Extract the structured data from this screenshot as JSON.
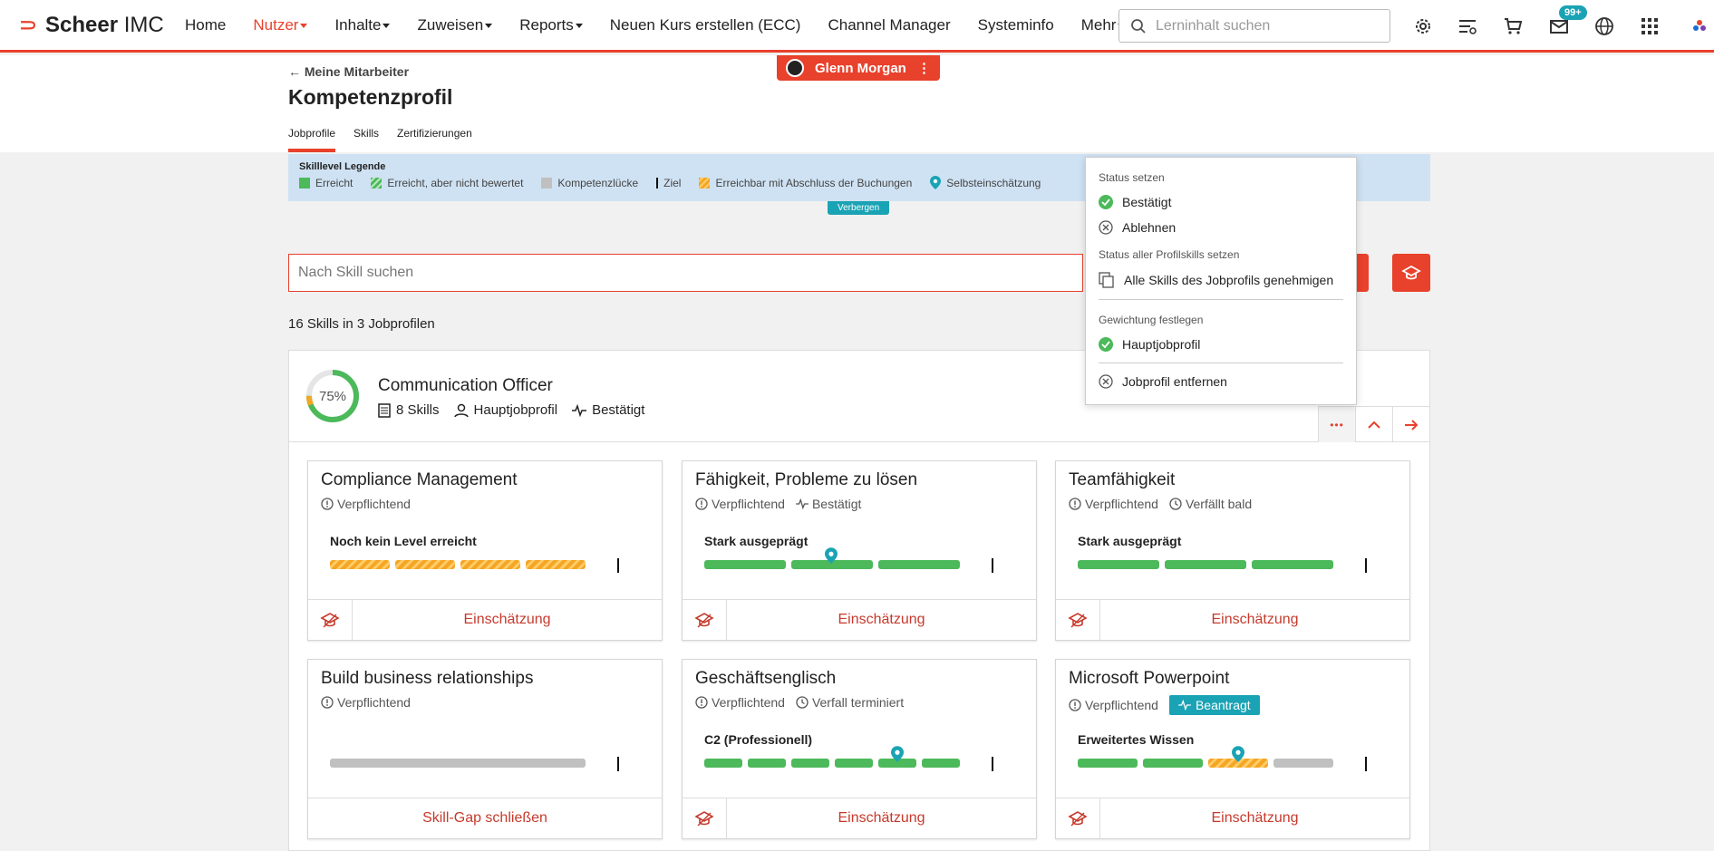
{
  "topbar": {
    "logo_brand": "Scheer",
    "logo_suffix": " IMC",
    "nav": [
      "Home",
      "Nutzer",
      "Inhalte",
      "Zuweisen",
      "Reports",
      "Neuen Kurs erstellen (ECC)",
      "Channel Manager",
      "Systeminfo",
      "Mehr"
    ],
    "search_placeholder": "Lerninhalt suchen",
    "mail_badge": "99+",
    "accent": "#e8412c"
  },
  "user_pill": {
    "name": "Glenn Morgan"
  },
  "header": {
    "back": "← Meine Mitarbeiter",
    "title": "Kompetenzprofil",
    "tabs": [
      "Jobprofile",
      "Skills",
      "Zertifizierungen"
    ]
  },
  "legend": {
    "title": "Skilllevel Legende",
    "items": [
      "Erreicht",
      "Erreicht, aber nicht bewertet",
      "Kompetenzlücke",
      "Ziel",
      "Erreichbar mit Abschluss der Buchungen",
      "Selbsteinschätzung"
    ],
    "hide": "Verbergen"
  },
  "skill_search": {
    "placeholder": "Nach Skill suchen"
  },
  "count": "16 Skills in 3 Jobprofilen",
  "profile": {
    "percent": "75%",
    "percent_value": 0.75,
    "name": "Communication Officer",
    "skills": "8 Skills",
    "type": "Hauptjobprofil",
    "status": "Bestätigt",
    "more": "•••"
  },
  "cards": [
    {
      "name": "Compliance Management",
      "mandatory": "Verpflichtend",
      "extra": "",
      "level": "Noch kein Level erreicht",
      "action": "Einschätzung"
    },
    {
      "name": "Fähigkeit, Probleme zu lösen",
      "mandatory": "Verpflichtend",
      "extra": "Bestätigt",
      "level": "Stark ausgeprägt",
      "action": "Einschätzung"
    },
    {
      "name": "Teamfähigkeit",
      "mandatory": "Verpflichtend",
      "extra": "Verfällt bald",
      "level": "Stark ausgeprägt",
      "action": "Einschätzung"
    },
    {
      "name": "Build business relationships",
      "mandatory": "Verpflichtend",
      "extra": "",
      "level": "",
      "action": "Skill-Gap schließen"
    },
    {
      "name": "Geschäftsenglisch",
      "mandatory": "Verpflichtend",
      "extra": "Verfall terminiert",
      "level": "C2 (Professionell)",
      "action": "Einschätzung"
    },
    {
      "name": "Microsoft Powerpoint",
      "mandatory": "Verpflichtend",
      "extra": "Beantragt",
      "level": "Erweitertes Wissen",
      "action": "Einschätzung"
    }
  ],
  "menu": {
    "sec1": "Status setzen",
    "confirm": "Bestätigt",
    "reject": "Ablehnen",
    "sec2": "Status aller Profilskills setzen",
    "approve_all": "Alle Skills des Jobprofils genehmigen",
    "sec3": "Gewichtung festlegen",
    "main": "Hauptjobprofil",
    "remove": "Jobprofil entfernen"
  }
}
